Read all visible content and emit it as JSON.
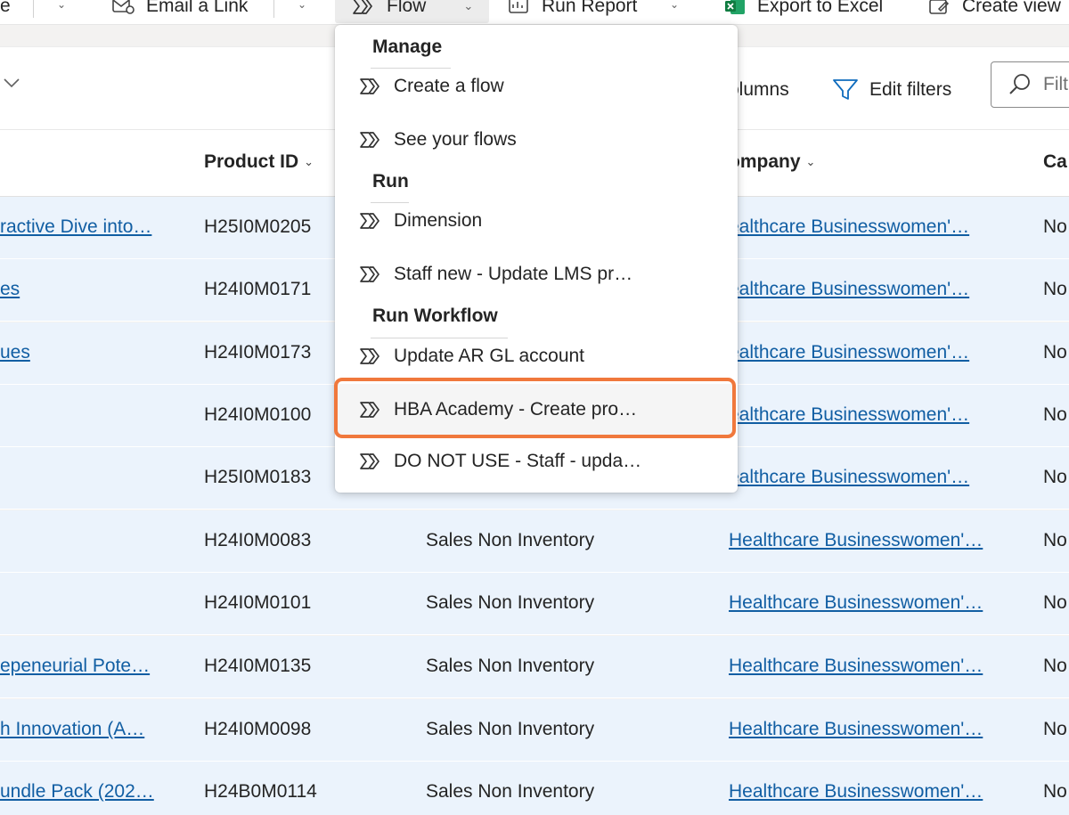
{
  "commandbar": {
    "partial_left_label": "e",
    "email_link_label": "Email a Link",
    "flow_label": "Flow",
    "run_report_label": "Run Report",
    "export_excel_label": "Export to Excel",
    "create_view_label": "Create view"
  },
  "viewbar": {
    "edit_columns_partial": "olumns",
    "edit_filters_label": "Edit filters",
    "filter_placeholder": "Filt"
  },
  "grid": {
    "columns": {
      "product_id": "Product ID",
      "company": "ompany",
      "category_partial": "Ca"
    },
    "rows": [
      {
        "name": "ractive Dive into…",
        "product_id": "H25I0M0205",
        "type": "",
        "company": "ealthcare Businesswomen'…",
        "cat": "No"
      },
      {
        "name": "es",
        "product_id": "H24I0M0171",
        "type": "",
        "company": "ealthcare Businesswomen'…",
        "cat": "No"
      },
      {
        "name": "ues",
        "product_id": "H24I0M0173",
        "type": "",
        "company": "ealthcare Businesswomen'…",
        "cat": "No"
      },
      {
        "name": "",
        "product_id": "H24I0M0100",
        "type": "",
        "company": "ealthcare Businesswomen'…",
        "cat": "No"
      },
      {
        "name": "",
        "product_id": "H25I0M0183",
        "type": "",
        "company": "ealthcare Businesswomen'…",
        "cat": "No"
      },
      {
        "name": "",
        "product_id": "H24I0M0083",
        "type": "Sales Non Inventory",
        "company": "Healthcare Businesswomen'…",
        "cat": "No"
      },
      {
        "name": "",
        "product_id": "H24I0M0101",
        "type": "Sales Non Inventory",
        "company": "Healthcare Businesswomen'…",
        "cat": "No"
      },
      {
        "name": "epeneurial Pote…",
        "product_id": "H24I0M0135",
        "type": "Sales Non Inventory",
        "company": "Healthcare Businesswomen'…",
        "cat": "No"
      },
      {
        "name": "h Innovation (A…",
        "product_id": "H24I0M0098",
        "type": "Sales Non Inventory",
        "company": "Healthcare Businesswomen'…",
        "cat": "No"
      },
      {
        "name": "undle Pack (202…",
        "product_id": "H24B0M0114",
        "type": "Sales Non Inventory",
        "company": "Healthcare Businesswomen'…",
        "cat": "No"
      }
    ]
  },
  "flow_menu": {
    "sections": [
      {
        "heading": "Manage",
        "items": [
          "Create a flow",
          "See your flows"
        ]
      },
      {
        "heading": "Run",
        "items": [
          "Dimension",
          "Staff new - Update LMS pr…"
        ]
      },
      {
        "heading": "Run Workflow",
        "items": [
          "Update AR GL account",
          "HBA Academy - Create pro…",
          "DO NOT USE - Staff - upda…"
        ]
      }
    ]
  },
  "colors": {
    "accent_link": "#115ea3",
    "row_selected_bg": "#ebf3fc",
    "highlight_outline": "#f0783c"
  },
  "icons": {
    "flow": "flow-icon",
    "email": "email-link-icon",
    "report": "report-icon",
    "excel": "excel-icon",
    "create_view": "create-view-icon",
    "filter": "filter-funnel-icon",
    "search": "search-icon"
  }
}
